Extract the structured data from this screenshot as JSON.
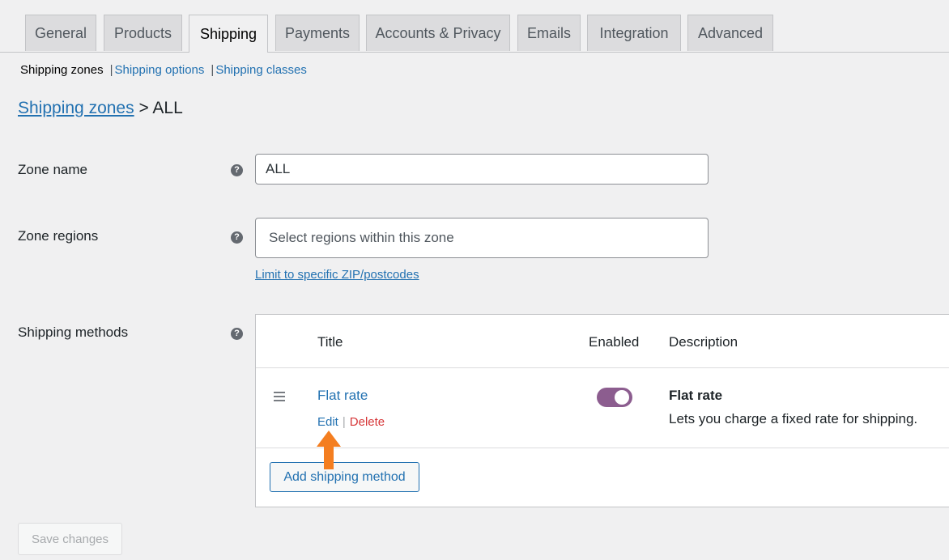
{
  "tabs": [
    "General",
    "Products",
    "Shipping",
    "Payments",
    "Accounts & Privacy",
    "Emails",
    "Integration",
    "Advanced"
  ],
  "subnav": {
    "current": "Shipping zones",
    "separator": "|",
    "options": "Shipping options",
    "classes": "Shipping classes"
  },
  "breadcrumb": {
    "link": "Shipping zones",
    "rest": "> ALL"
  },
  "form": {
    "zone_name_label": "Zone name",
    "zone_name_value": "ALL",
    "zone_regions_label": "Zone regions",
    "zone_regions_placeholder": "Select regions within this zone",
    "limit_link": "Limit to specific ZIP/postcodes",
    "methods_label": "Shipping methods",
    "help_glyph": "?"
  },
  "methods_table": {
    "headers": {
      "title": "Title",
      "enabled": "Enabled",
      "description": "Description"
    },
    "row": {
      "title": "Flat rate",
      "edit": "Edit",
      "separator": "|",
      "delete": "Delete",
      "enabled": true,
      "desc_title": "Flat rate",
      "desc_text": "Lets you charge a fixed rate for shipping."
    },
    "add_button": "Add shipping method"
  },
  "save_button": "Save changes",
  "colors": {
    "link": "#2271b1",
    "delete": "#d63638",
    "toggle_on": "#8c5d8f",
    "annotation_arrow": "#f47e20"
  }
}
